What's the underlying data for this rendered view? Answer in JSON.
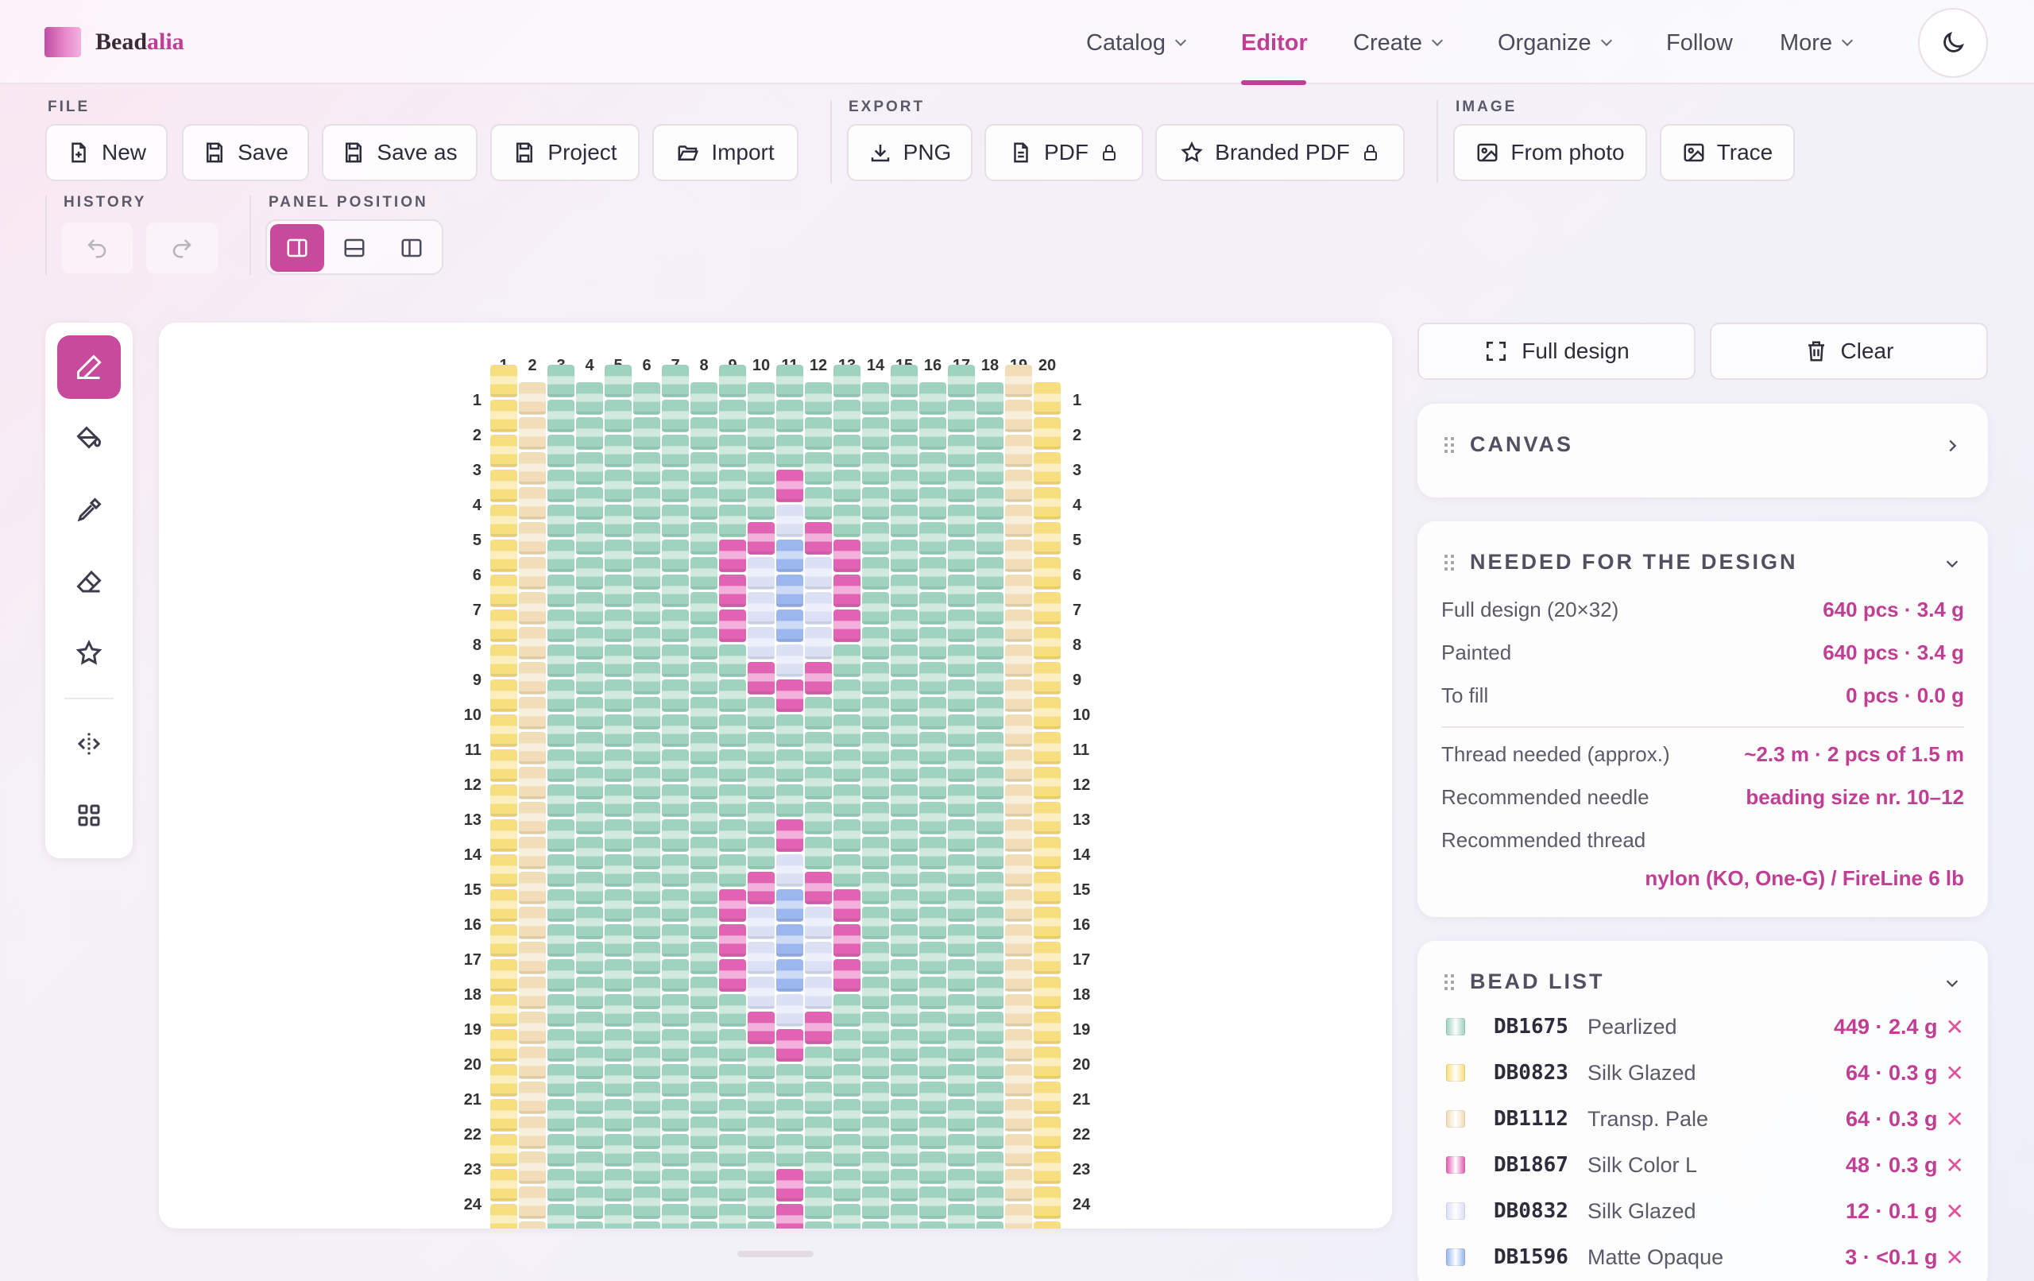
{
  "brand": {
    "name_a": "Bead",
    "name_b": "alia"
  },
  "nav": {
    "items": [
      {
        "label": "Catalog",
        "dropdown": true
      },
      {
        "label": "Editor",
        "dropdown": false,
        "active": true
      },
      {
        "label": "Create",
        "dropdown": true
      },
      {
        "label": "Organize",
        "dropdown": true
      },
      {
        "label": "Follow",
        "dropdown": false
      },
      {
        "label": "More",
        "dropdown": true
      }
    ],
    "theme_toggle_icon": "moon-icon"
  },
  "toolbar": {
    "file": {
      "label": "FILE",
      "buttons": [
        "New",
        "Save",
        "Save as",
        "Project",
        "Import"
      ]
    },
    "export": {
      "label": "EXPORT",
      "buttons": [
        "PNG",
        "PDF",
        "Branded PDF"
      ]
    },
    "image": {
      "label": "IMAGE",
      "buttons": [
        "From photo",
        "Trace"
      ]
    },
    "history": {
      "label": "HISTORY"
    },
    "panel_position": {
      "label": "PANEL POSITION"
    }
  },
  "tools": [
    "pencil-icon",
    "fill-bucket-icon",
    "eyedropper-icon",
    "eraser-icon",
    "star-icon",
    "mirror-icon",
    "grid-icon"
  ],
  "canvas": {
    "columns": [
      "1",
      "2",
      "3",
      "4",
      "5",
      "6",
      "7",
      "8",
      "9",
      "10",
      "11",
      "12",
      "13",
      "14",
      "15",
      "16",
      "17",
      "18",
      "19",
      "20"
    ],
    "rows": [
      "1",
      "2",
      "3",
      "4",
      "5",
      "6",
      "7",
      "8",
      "9",
      "10",
      "11",
      "12",
      "13",
      "14",
      "15",
      "16",
      "17",
      "18",
      "19",
      "20",
      "21",
      "22",
      "23",
      "24"
    ],
    "colors": {
      "A": "#9fd3bf",
      "Y": "#f7df7f",
      "T": "#f1ddb8",
      "P": "#e262b4",
      "L": "#dbe0f4",
      "B": "#9bb7ee"
    }
  },
  "actions": {
    "full_design": "Full design",
    "clear": "Clear"
  },
  "canvas_card": {
    "title": "CANVAS"
  },
  "needed": {
    "title": "NEEDED FOR THE DESIGN",
    "rows": [
      {
        "k": "Full design (20×32)",
        "v": "640 pcs · 3.4 g"
      },
      {
        "k": "Painted",
        "v": "640 pcs · 3.4 g"
      },
      {
        "k": "To fill",
        "v": "0 pcs · 0.0 g"
      },
      {
        "k": "Thread needed (approx.)",
        "v": "~2.3 m · 2 pcs of 1.5 m"
      },
      {
        "k": "Recommended needle",
        "v": "beading size nr. 10–12"
      },
      {
        "k": "Recommended thread",
        "v": ""
      }
    ],
    "thread_value": "nylon (KO, One-G) / FireLine 6 lb"
  },
  "bead_list": {
    "title": "BEAD LIST",
    "items": [
      {
        "code": "DB1675",
        "finish": "Pearlized",
        "qty": "449 · 2.4 g",
        "color": "#9fd3bf"
      },
      {
        "code": "DB0823",
        "finish": "Silk Glazed",
        "qty": "64 · 0.3 g",
        "color": "#f7df7f"
      },
      {
        "code": "DB1112",
        "finish": "Transp. Pale",
        "qty": "64 · 0.3 g",
        "color": "#f1ddb8"
      },
      {
        "code": "DB1867",
        "finish": "Silk Color L",
        "qty": "48 · 0.3 g",
        "color": "#e262b4"
      },
      {
        "code": "DB0832",
        "finish": "Silk Glazed",
        "qty": "12 · 0.1 g",
        "color": "#dbe0f4"
      },
      {
        "code": "DB1596",
        "finish": "Matte Opaque",
        "qty": "3 · <0.1 g",
        "color": "#9bb7ee"
      }
    ],
    "remove_glyph": "✕"
  }
}
